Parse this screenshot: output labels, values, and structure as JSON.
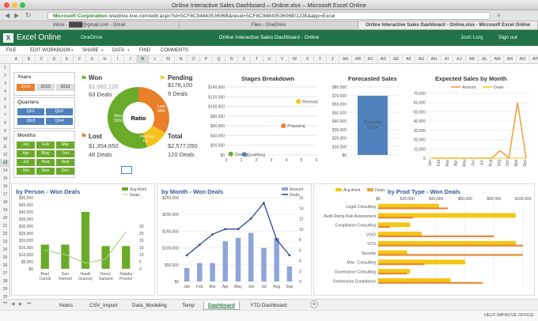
{
  "window": {
    "title": "Online Interactive Sales Dashboard – Online.xlsx – Microsoft Excel Online"
  },
  "browser": {
    "corp": "Microsoft Corporation",
    "url": "onedrive.live.com/edit.aspx?id=5CF8C9484353606B&resid=5CF8C9484353606B!1235&app=Excel",
    "tabs": [
      "Inbox - ████@gmail.com - Gmail",
      "Files - OneDrive",
      "Online Interactive Sales Dashboard - Online.xlsx - Microsoft Excel Online"
    ]
  },
  "app": {
    "name": "Excel Online",
    "onedrive": "OneDrive",
    "doc": "Online Interactive Sales Dashboard - Online",
    "user": "Josh Lorg",
    "signout": "Sign out"
  },
  "menu": [
    "FILE",
    "EDIT WORKBOOK",
    "SHARE",
    "DATA",
    "FIND",
    "COMMENTS"
  ],
  "columns": [
    "A",
    "B",
    "C",
    "D",
    "E",
    "F",
    "G",
    "H",
    "I",
    "J",
    "K",
    "L",
    "M",
    "N",
    "O",
    "P",
    "Q",
    "R",
    "S",
    "T",
    "U",
    "V",
    "W",
    "X",
    "Y",
    "Z",
    "AA",
    "AB",
    "AC",
    "AD",
    "AE",
    "AF",
    "AG",
    "AH",
    "AI",
    "AJ",
    "AK",
    "AL",
    "AM",
    "AN",
    "AO",
    "AP"
  ],
  "rows": [
    "1",
    "2",
    "3",
    "4",
    "5",
    "6",
    "7",
    "8",
    "9",
    "10",
    "11",
    "12",
    "13",
    "14",
    "15",
    "16",
    "17",
    "18",
    "19",
    "20",
    "21",
    "22",
    "23",
    "24",
    "25",
    "26",
    "27",
    "28",
    "29",
    "30"
  ],
  "slicers": {
    "years": {
      "title": "Years",
      "items": [
        "2014",
        "2013",
        "2012"
      ]
    },
    "quarters": {
      "title": "Quarters",
      "items": [
        "Qtr1",
        "Qtr2",
        "Qtr3",
        "Qtr4"
      ]
    },
    "months": {
      "title": "Months",
      "items": [
        "Jan",
        "Feb",
        "Mar",
        "Apr",
        "May",
        "Jun",
        "Jul",
        "Aug",
        "Sep",
        "Oct",
        "Nov",
        "Dec"
      ]
    }
  },
  "kpi": {
    "won": {
      "label": "Won",
      "amount": "$1,062,120",
      "deals": "63 Deals"
    },
    "pending": {
      "label": "Pending",
      "amount": "$178,100",
      "deals": "9 Deals"
    },
    "lost": {
      "label": "Lost",
      "amount": "$1,354,650",
      "deals": "48 Deals"
    },
    "total": {
      "label": "Total",
      "amount": "$2,577,050",
      "deals": "120 Deals"
    },
    "ratio": "Ratio",
    "donut": {
      "won_label": "Won",
      "won_pct": "53%",
      "lost_label": "Lost",
      "lost_pct": "40%",
      "pending_label": "Pending",
      "pending_pct": "7%"
    }
  },
  "charts": {
    "stages": {
      "title": "Stages Breakdown",
      "yticks": [
        "$140,000",
        "$120,000",
        "$100,000",
        "$80,000",
        "$60,000",
        "$40,000",
        "$20,000",
        "$0"
      ],
      "xticks": [
        "0",
        "1",
        "2",
        "3",
        "4",
        "5",
        "6"
      ],
      "points": [
        {
          "label": "Renewal",
          "x": 4.8,
          "y": 110000
        },
        {
          "label": "Proposing",
          "x": 3.8,
          "y": 60000
        },
        {
          "label": "Closing",
          "x": 0.3,
          "y": 2000
        },
        {
          "label": "Qualifying",
          "x": 1.2,
          "y": 1000
        }
      ]
    },
    "forecast": {
      "title": "Forecasted Sales",
      "yticks": [
        "$80,000",
        "$70,000",
        "$60,000",
        "$50,000",
        "$40,000",
        "$30,000",
        "$20,000",
        "$10,000",
        "$0"
      ],
      "label": "Proposing",
      "value": "27,300"
    },
    "expected": {
      "title": "Expected Sales by Month",
      "legend": [
        "Amount",
        "Deals"
      ],
      "yticks": [
        "70,000",
        "60,000",
        "50,000",
        "40,000",
        "30,000",
        "20,000",
        "10,000",
        "0"
      ],
      "months": [
        "Jan",
        "Feb",
        "Mar",
        "Apr",
        "May",
        "Jun",
        "Jul",
        "Aug",
        "Sep",
        "Oct",
        "Nov",
        "Dec"
      ],
      "amount": [
        0,
        0,
        0,
        0,
        0,
        0,
        0,
        0,
        8000,
        0,
        60000,
        0
      ],
      "deals": [
        0,
        0,
        0,
        0,
        0,
        0,
        0,
        0,
        0,
        0,
        0,
        0
      ]
    },
    "person": {
      "title": "by Person - Won Deals",
      "legend": [
        "Avg Amnt",
        "Deals"
      ],
      "yticks": [
        "$50,000",
        "$45,000",
        "$40,000",
        "$35,000",
        "$30,000",
        "$25,000",
        "$20,000",
        "$15,000",
        "$10,000",
        "$5,000",
        "$0"
      ],
      "y2ticks": [
        "30",
        "25",
        "20",
        "15",
        "10",
        "5",
        "0"
      ],
      "people": [
        "Brad Carroll",
        "Dan Hamsel",
        "Heath Granuty",
        "Henry Garland",
        "Natalia Proctor"
      ],
      "avg": [
        17000,
        17000,
        40000,
        16000,
        16000
      ],
      "deals": [
        13,
        10,
        4,
        7,
        26
      ]
    },
    "month": {
      "title": "by Month - Won Deals",
      "legend": [
        "Amount",
        "Deals"
      ],
      "yticks": [
        "$250,000",
        "$200,000",
        "$150,000",
        "$100,000",
        "$50,000",
        "$0"
      ],
      "y2ticks": [
        "16",
        "14",
        "12",
        "10",
        "8",
        "6",
        "4",
        "2",
        "0"
      ],
      "months": [
        "Jan",
        "Feb",
        "Mar",
        "Apr",
        "May",
        "Jun",
        "Jul",
        "Aug",
        "Sep"
      ],
      "amount": [
        45000,
        65000,
        50000,
        110000,
        85000,
        140000,
        100000,
        130000,
        60000
      ],
      "bars": [
        40000,
        55000,
        55000,
        120000,
        130000,
        145000,
        100000,
        130000,
        45000
      ],
      "deals": [
        5,
        7,
        9,
        10,
        10,
        12,
        15,
        8,
        5
      ]
    },
    "prod": {
      "title": "by Prod Type - Won Deals",
      "legend": [
        "Avg Amnt",
        "Deals"
      ],
      "xticks": [
        "$0",
        "$20,000",
        "$40,000",
        "$60,000",
        "$80,000",
        "$100,000"
      ],
      "x2ticks": [
        "0",
        "5",
        "10",
        "15",
        "20",
        "25"
      ],
      "types": [
        "Legal Consulting",
        "Audit Ramp Risk Assessment",
        "Compliance Consulting",
        "VISO",
        "VCO",
        "Security",
        "Misc. Consulting",
        "Governance Consulting",
        "Gentreanna Compliance"
      ],
      "avg": [
        42000,
        95000,
        22000,
        30000,
        95000,
        20000,
        60000,
        22000,
        50000
      ],
      "deals": [
        12,
        6,
        2,
        20,
        25,
        25,
        8,
        5,
        18
      ]
    }
  },
  "sheets": [
    "Notes",
    "CSV_Import",
    "Data_Modeling",
    "Temp",
    "Dashboard",
    "YTD Dashboard"
  ],
  "active_sheet": "Dashboard",
  "status": "HELP IMPROVE OFFICE",
  "colors": {
    "green": "#217346",
    "won": "#6aab2a",
    "lost": "#ea7f2a",
    "pending": "#f5c31c",
    "blue": "#4f81bd",
    "orange": "#f39c36",
    "yellow": "#f5c518"
  }
}
